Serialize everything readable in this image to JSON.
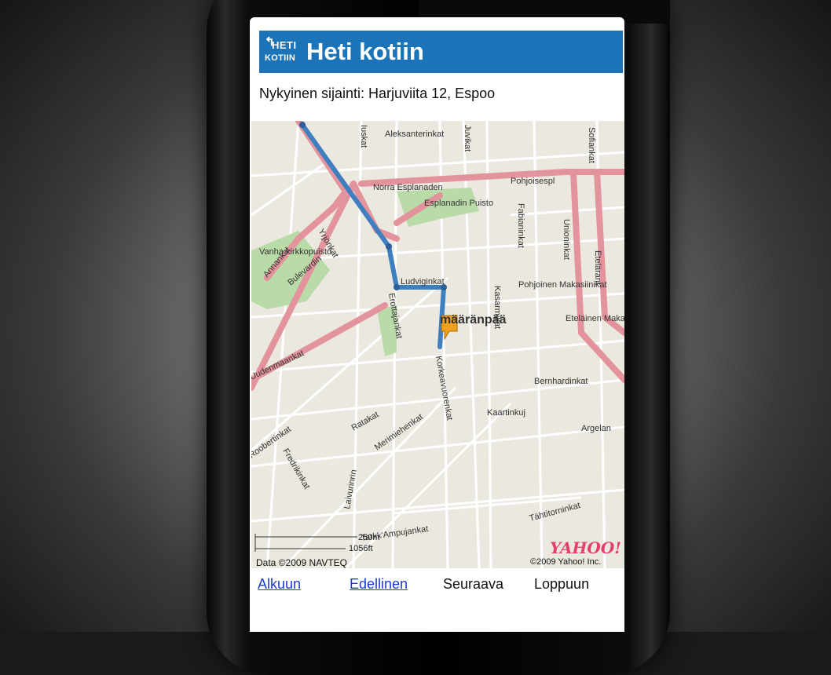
{
  "app": {
    "title": "Heti kotiin",
    "logo_line1": "HETI",
    "logo_line2": "KOTIIN",
    "logo_arrow": "↰"
  },
  "location": "Nykyinen sijainti: Harjuviita 12, Espoo",
  "map": {
    "destination_label": "määränpää",
    "streets": [
      "Aleksanterinkat",
      "Pohjoisespl",
      "Norra Esplanaden",
      "Esplanadin Puisto",
      "Fabianinkat",
      "Unioninkat",
      "Etelärant",
      "Sofiankat",
      "Vanha kirkkopuisto",
      "Yrjönkat",
      "Annankat",
      "Bulevardin",
      "Erottajankat",
      "Ludviginkat",
      "Pohjoinen Makasiinikat",
      "Eteläinen Makasiinikat",
      "Kasarmikat",
      "Korkeavuorenkat",
      "Bernhardinkat",
      "Kaartinkuj",
      "Argelan",
      "Uudenmaankat",
      "Roobertinkat",
      "Ratakat",
      "Merimiehenkat",
      "Fredrikinkat",
      "Laivurinrin",
      "Tarkk'Ampujankat",
      "Tähtitorninkat",
      "Iuskat",
      "Juvikat"
    ],
    "scale_metric": "250m",
    "scale_imperial": "1056ft",
    "copyright_left": "Data ©2009 NAVTEQ",
    "copyright_right": "©2009 Yahoo! Inc.",
    "brand": "YAHOO!"
  },
  "nav": {
    "first": "Alkuun",
    "prev": "Edellinen",
    "next": "Seuraava",
    "last": "Loppuun"
  },
  "colors": {
    "header": "#1b74b8",
    "route": "#3f7fc0",
    "main_road": "#e3939c",
    "park": "#b9dba8",
    "marker": "#f0a020"
  }
}
